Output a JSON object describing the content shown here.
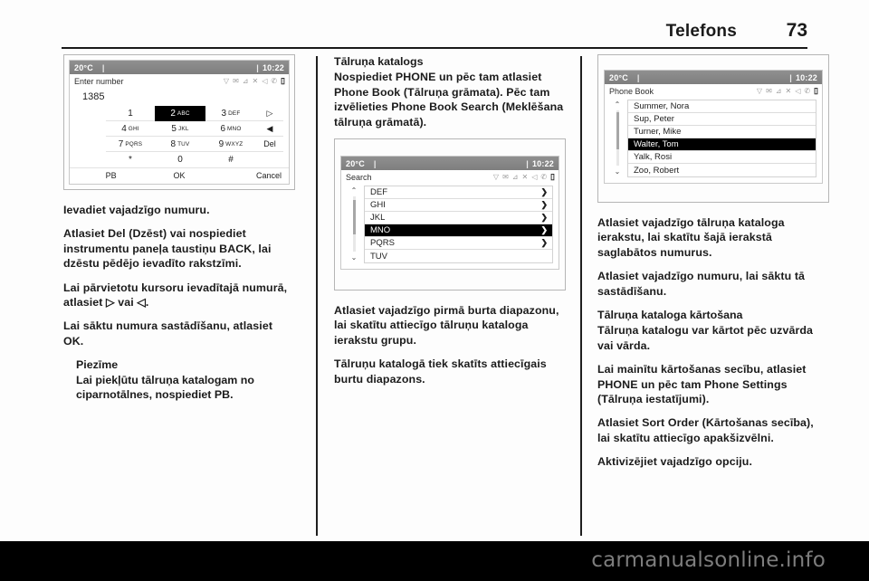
{
  "header": {
    "title": "Telefons",
    "page_number": "73"
  },
  "footer": {
    "watermark": "carmanualsonline.info"
  },
  "colors": {
    "page_bg": "#000000",
    "paper_bg": "#fdfdfd",
    "text": "#1b1b1b",
    "statusbar_bg": "#868686",
    "selection_bg": "#000000",
    "selection_fg": "#ffffff"
  },
  "screens": {
    "dialer": {
      "statusbar": {
        "temperature": "20°C",
        "separator": "|",
        "clock": "10:22"
      },
      "title": "Enter number",
      "status_icons": [
        "wifi-icon",
        "envelope-icon",
        "signal-icon",
        "shuffle-icon",
        "mute-icon",
        "phone-handset-icon",
        "battery-icon"
      ],
      "entered_number": "1385",
      "keys": [
        {
          "digit": "1",
          "letters": "",
          "selected": false
        },
        {
          "digit": "2",
          "letters": "ABC",
          "selected": true
        },
        {
          "digit": "3",
          "letters": "DEF",
          "selected": false
        },
        {
          "digit": "4",
          "letters": "GHI",
          "selected": false
        },
        {
          "digit": "5",
          "letters": "JKL",
          "selected": false
        },
        {
          "digit": "6",
          "letters": "MNO",
          "selected": false
        },
        {
          "digit": "7",
          "letters": "PQRS",
          "selected": false
        },
        {
          "digit": "8",
          "letters": "TUV",
          "selected": false
        },
        {
          "digit": "9",
          "letters": "WXYZ",
          "selected": false
        },
        {
          "digit": "*",
          "letters": "",
          "selected": false
        },
        {
          "digit": "0",
          "letters": "",
          "selected": false
        },
        {
          "digit": "#",
          "letters": "",
          "selected": false
        }
      ],
      "side_keys": [
        "▷",
        "◀",
        "Del"
      ],
      "softkeys": [
        "PB",
        "OK",
        "Cancel"
      ]
    },
    "search": {
      "statusbar": {
        "temperature": "20°C",
        "separator": "|",
        "clock": "10:22"
      },
      "title": "Search",
      "items": [
        {
          "label": "DEF",
          "chevron": "❯",
          "selected": false
        },
        {
          "label": "GHI",
          "chevron": "❯",
          "selected": false
        },
        {
          "label": "JKL",
          "chevron": "❯",
          "selected": false
        },
        {
          "label": "MNO",
          "chevron": "❯",
          "selected": true
        },
        {
          "label": "PQRS",
          "chevron": "❯",
          "selected": false
        },
        {
          "label": "TUV",
          "chevron": "",
          "selected": false
        }
      ],
      "scroll_up": "⌃",
      "scroll_down": "⌄"
    },
    "phonebook": {
      "statusbar": {
        "temperature": "20°C",
        "separator": "|",
        "clock": "10:22"
      },
      "title": "Phone Book",
      "items": [
        {
          "label": "Summer, Nora",
          "chevron": "",
          "selected": false
        },
        {
          "label": "Sup, Peter",
          "chevron": "",
          "selected": false
        },
        {
          "label": "Turner, Mike",
          "chevron": "",
          "selected": false
        },
        {
          "label": "Walter, Tom",
          "chevron": "",
          "selected": true
        },
        {
          "label": "Yalk, Rosi",
          "chevron": "",
          "selected": false
        },
        {
          "label": "Zoo, Robert",
          "chevron": "",
          "selected": false
        }
      ],
      "scroll_up": "⌃",
      "scroll_down": "⌄"
    }
  },
  "column1": {
    "p1": "Ievadiet vajadzīgo numuru.",
    "p2": "Atlasiet Del (Dzēst) vai nospiediet instrumentu paneļa taustiņu BACK, lai dzēstu pēdējo ievadīto rakstzīmi.",
    "p3": "Lai pārvietotu kursoru ievadītajā numurā, atlasiet ▷ vai ◁.",
    "p4": "Lai sāktu numura sastādīšanu, atlasiet OK.",
    "note_title": "Piezīme",
    "note_text": "Lai piekļūtu tālruņa katalogam no ciparnotālnes, nospiediet PB."
  },
  "column2": {
    "heading": "Tālruņa katalogs",
    "p1": "Nospiediet PHONE un pēc tam atlasiet Phone Book (Tālruņa grāmata). Pēc tam izvēlieties Phone Book Search (Meklēšana tālruņa grāmatā).",
    "p2": "Atlasiet vajadzīgo pirmā burta diapazonu, lai skatītu attiecīgo tālruņu kataloga ierakstu grupu.",
    "p3": "Tālruņu katalogā tiek skatīts attiecīgais burtu diapazons."
  },
  "column3": {
    "p1": "Atlasiet vajadzīgo tālruņa kataloga ierakstu, lai skatītu šajā ierakstā saglabātos numurus.",
    "p2": "Atlasiet vajadzīgo numuru, lai sāktu tā sastādīšanu.",
    "heading": "Tālruņa kataloga kārtošana",
    "p3": "Tālruņa katalogu var kārtot pēc uzvārda vai vārda.",
    "p4": "Lai mainītu kārtošanas secību, atlasiet PHONE un pēc tam Phone Settings (Tālruņa iestatījumi).",
    "p5": "Atlasiet Sort Order (Kārtošanas secība), lai skatītu attiecīgo apakšizvēlni.",
    "p6": "Aktivizējiet vajadzīgo opciju."
  }
}
